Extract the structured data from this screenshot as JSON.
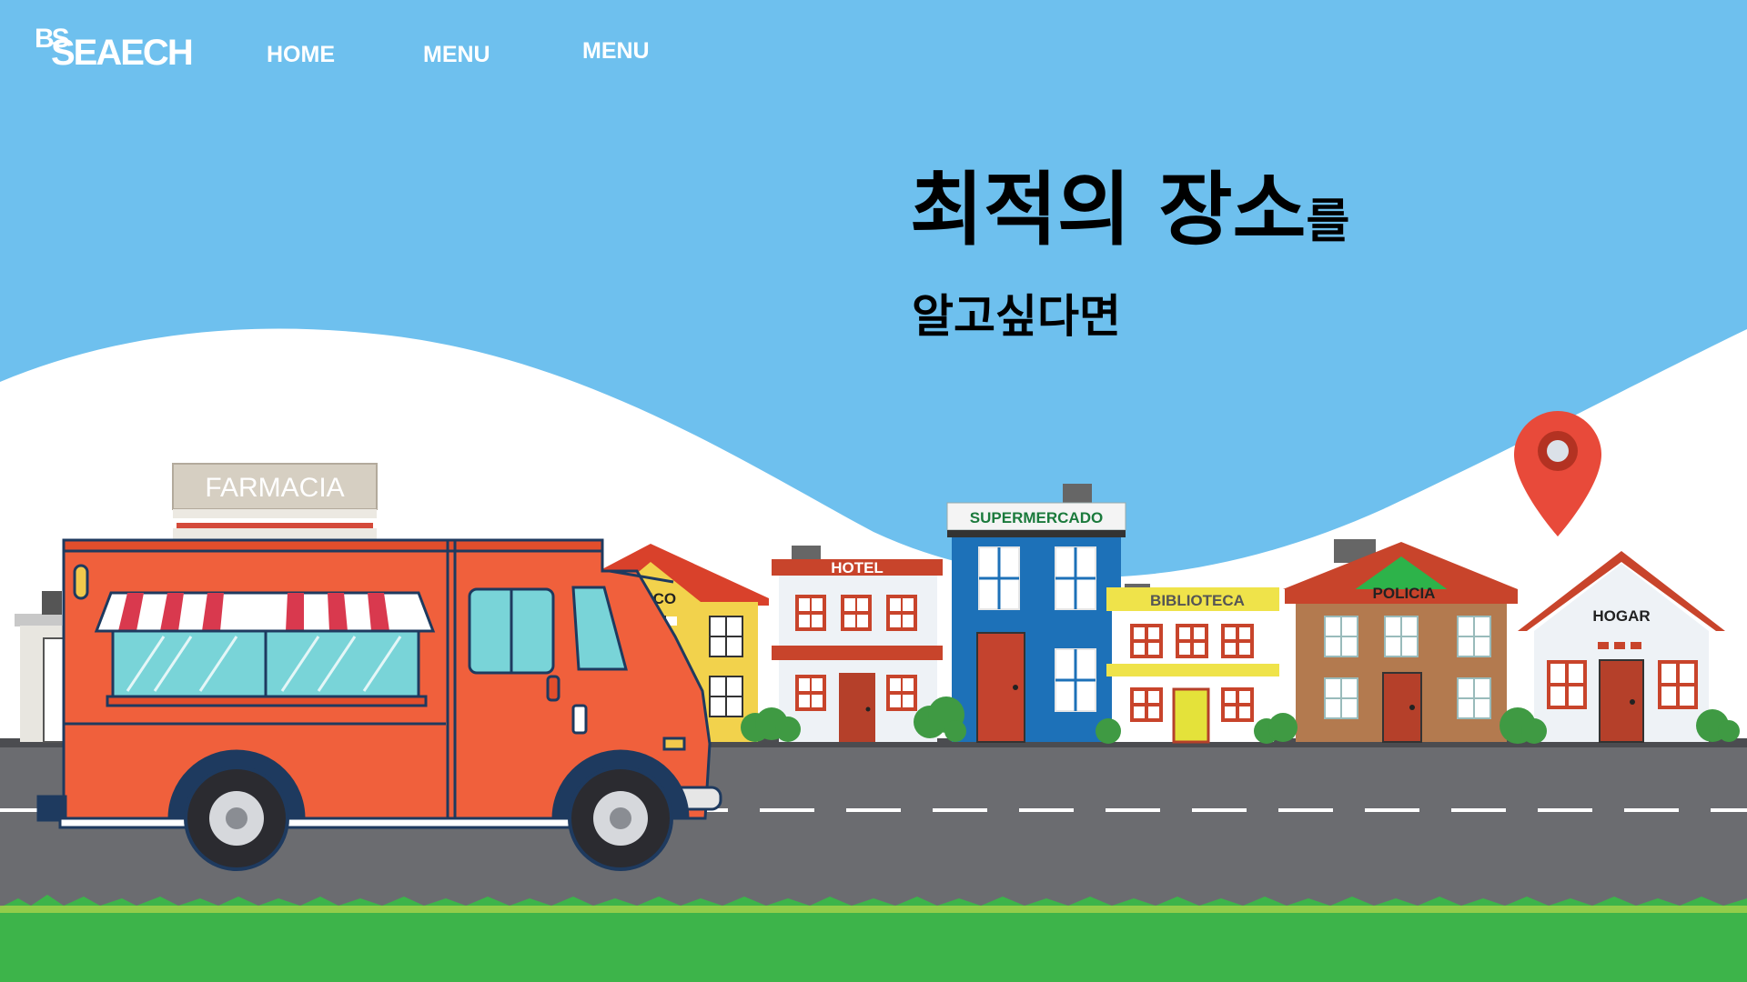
{
  "header": {
    "logo_small": "BS",
    "logo_word": "SEAECH",
    "nav": [
      "HOME",
      "MENU",
      "MENU"
    ]
  },
  "hero": {
    "title_main": "최적의 장소",
    "title_particle": "를",
    "subtitle": "알고싶다면"
  },
  "scene": {
    "signs": {
      "farmacia": "FARMACIA",
      "banco": "BANCO",
      "hotel": "HOTEL",
      "supermercado": "SUPERMERCADO",
      "biblioteca": "BIBLIOTECA",
      "policia": "POLICIA",
      "hogar": "HOGAR"
    },
    "pin_icon": "map-pin-icon"
  },
  "colors": {
    "sky": "#6ec0ee",
    "road": "#6b6c70",
    "grass": "#3db44a",
    "truck": "#f0603c",
    "pin": "#e84a3a"
  }
}
